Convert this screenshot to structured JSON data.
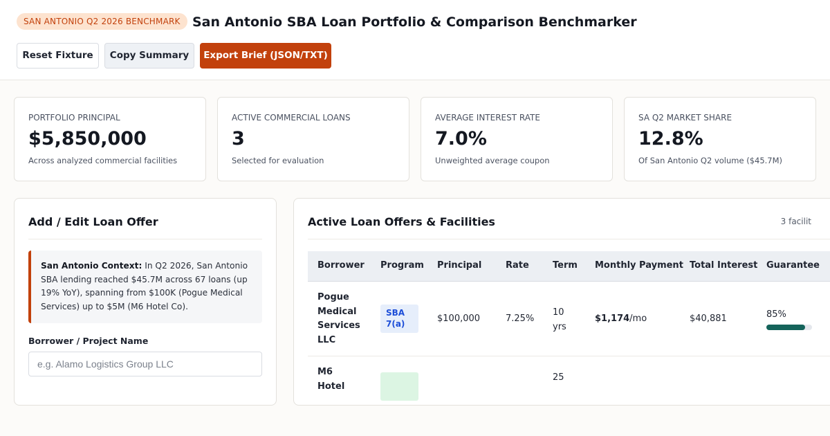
{
  "header": {
    "badge": "SAN ANTONIO Q2 2026 BENCHMARK",
    "title": "San Antonio SBA Loan Portfolio & Comparison Benchmarker",
    "buttons": {
      "reset": "Reset Fixture",
      "copy": "Copy Summary",
      "export": "Export Brief (JSON/TXT)"
    }
  },
  "kpis": [
    {
      "label": "PORTFOLIO PRINCIPAL",
      "value": "$5,850,000",
      "sub": "Across analyzed commercial facilities"
    },
    {
      "label": "ACTIVE COMMERCIAL LOANS",
      "value": "3",
      "sub": "Selected for evaluation"
    },
    {
      "label": "AVERAGE INTEREST RATE",
      "value": "7.0%",
      "sub": "Unweighted average coupon"
    },
    {
      "label": "SA Q2 MARKET SHARE",
      "value": "12.8%",
      "sub": "Of San Antonio Q2 volume ($45.7M)"
    }
  ],
  "form": {
    "title": "Add / Edit Loan Offer",
    "context_label": "San Antonio Context:",
    "context_text": "In Q2 2026, San Antonio SBA lending reached $45.7M across 67 loans (up 19% YoY), spanning from $100K (Pogue Medical Services) up to $5M (M6 Hotel Co).",
    "borrower_label": "Borrower / Project Name",
    "borrower_placeholder": "e.g. Alamo Logistics Group LLC"
  },
  "table": {
    "title": "Active Loan Offers & Facilities",
    "count": "3 facilit",
    "columns": [
      "Borrower",
      "Program",
      "Principal",
      "Rate",
      "Term",
      "Monthly Payment",
      "Total Interest",
      "Guarantee"
    ],
    "rows": [
      {
        "borrower": "Pogue Medical Services LLC",
        "program": "SBA 7(a)",
        "principal": "$100,000",
        "rate": "7.25%",
        "term": "10 yrs",
        "monthly": "$1,174",
        "monthly_unit": "/mo",
        "total_interest": "$40,881",
        "guarantee": "85%",
        "guarantee_fraction": 0.85
      },
      {
        "borrower": "M6 Hotel",
        "term": "25"
      }
    ]
  },
  "colors": {
    "accent": "#c2410c",
    "badge_bg": "#fde3cf",
    "program_blue": "#1d4ed8",
    "guarantee_bar": "#14635a"
  }
}
